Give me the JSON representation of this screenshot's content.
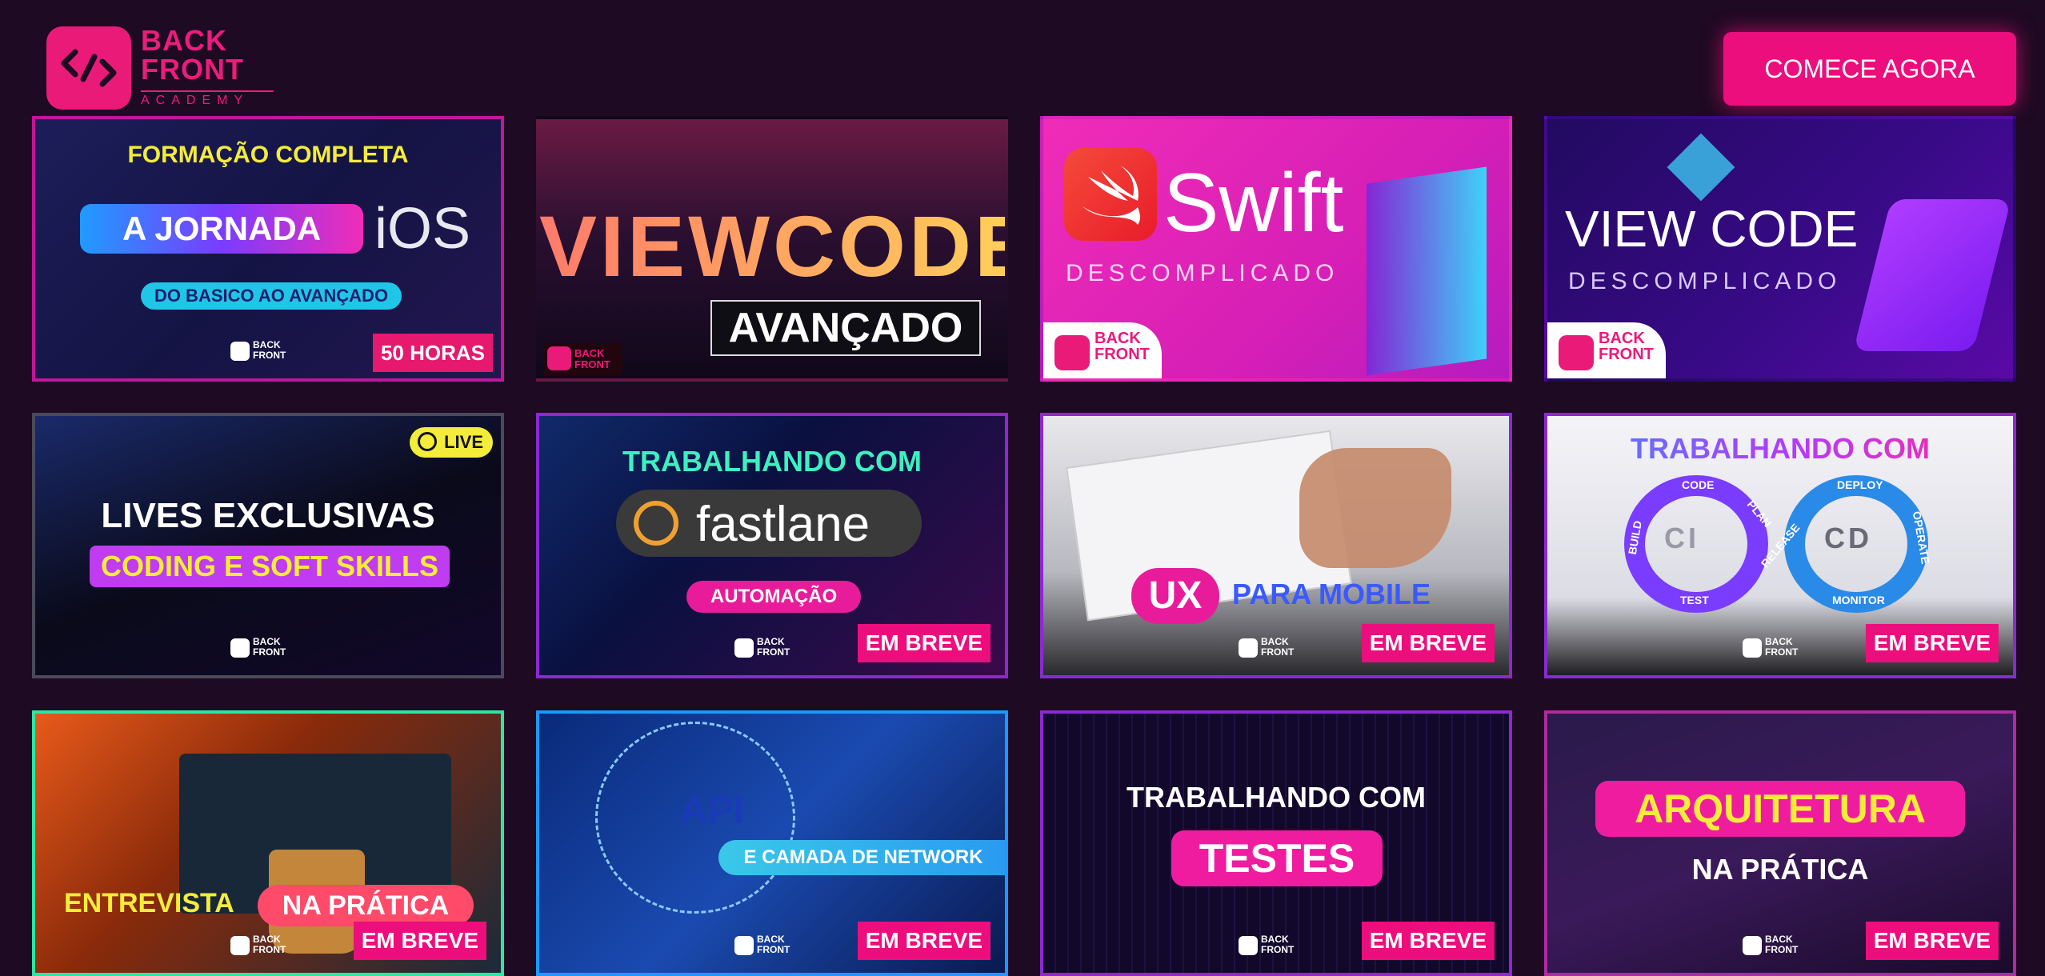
{
  "header": {
    "logo": {
      "line1": "BACK",
      "line2": "FRONT",
      "line3": "ACADEMY"
    },
    "cta_label": "COMECE AGORA"
  },
  "mini_logo": {
    "line1": "BACK",
    "line2": "FRONT"
  },
  "cards": [
    {
      "title_top": "FORMAÇÃO COMPLETA",
      "pill": "A JORNADA",
      "side": "iOS",
      "sub": "DO BASICO AO AVANÇADO",
      "badge": "50 HORAS"
    },
    {
      "line1": "VIEWCODE",
      "line2": "AVANÇADO"
    },
    {
      "line1": "Swift",
      "line2": "DESCOMPLICADO"
    },
    {
      "line1": "VIEW CODE",
      "line2": "DESCOMPLICADO"
    },
    {
      "live": "LIVE",
      "line1": "LIVES EXCLUSIVAS",
      "pill": "CODING E SOFT SKILLS"
    },
    {
      "title_top": "TRABALHANDO COM",
      "pill": "fastlane",
      "sub": "AUTOMAÇÃO",
      "badge": "EM BREVE"
    },
    {
      "pill": "UX",
      "side": "PARA MOBILE",
      "badge": "EM BREVE"
    },
    {
      "title_top": "TRABALHANDO COM",
      "labels": [
        "CI",
        "CD",
        "CODE",
        "PLAN",
        "RELEASE",
        "DEPLOY",
        "OPERATE",
        "MONITOR",
        "TEST",
        "BUILD"
      ],
      "badge": "EM BREVE"
    },
    {
      "line1": "ENTREVISTA",
      "pill": "NA PRÁTICA",
      "badge": "EM BREVE"
    },
    {
      "line1": "API",
      "pill": "E CAMADA DE NETWORK",
      "badge": "EM BREVE"
    },
    {
      "title_top": "TRABALHANDO COM",
      "pill": "TESTES",
      "badge": "EM BREVE"
    },
    {
      "pill": "ARQUITETURA",
      "side": "NA PRÁTICA",
      "badge": "EM BREVE"
    }
  ],
  "colors": {
    "background": "#1e0a22",
    "accent": "#ec0e7c"
  },
  "icons": [
    "logo-arrows-icon",
    "swift-bird-icon",
    "live-play-icon",
    "fastlane-star-icon",
    "coffee-mug-image"
  ]
}
